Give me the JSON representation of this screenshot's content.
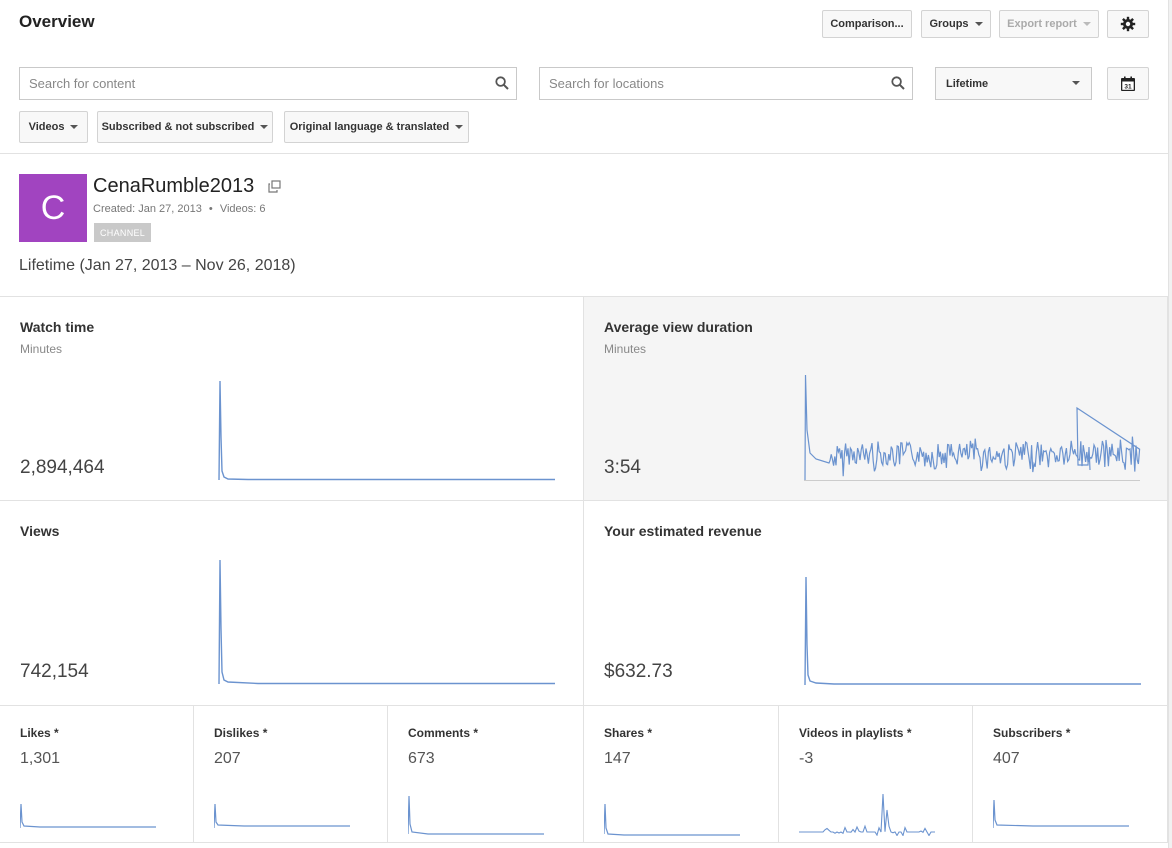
{
  "header": {
    "title": "Overview",
    "comparison_label": "Comparison...",
    "groups_label": "Groups",
    "export_label": "Export report"
  },
  "filters": {
    "content_search_placeholder": "Search for content",
    "location_search_placeholder": "Search for locations",
    "date_range": "Lifetime",
    "calendar_day": "31",
    "content_type": "Videos",
    "subscription": "Subscribed & not subscribed",
    "language": "Original language & translated"
  },
  "channel": {
    "avatar_letter": "C",
    "avatar_color": "#a144c0",
    "name": "CenaRumble2013",
    "created": "Created: Jan 27, 2013",
    "separator": "•",
    "videos": "Videos: 6",
    "badge": "CHANNEL",
    "range": "Lifetime (Jan 27, 2013 – Nov 26, 2018)"
  },
  "metrics": {
    "watch_time": {
      "label": "Watch time",
      "unit": "Minutes",
      "value": "2,894,464"
    },
    "avg_duration": {
      "label": "Average view duration",
      "unit": "Minutes",
      "value": "3:54"
    },
    "views": {
      "label": "Views",
      "value": "742,154"
    },
    "revenue": {
      "label": "Your estimated revenue",
      "value": "$632.73"
    }
  },
  "small_metrics": [
    {
      "label": "Likes *",
      "value": "1,301"
    },
    {
      "label": "Dislikes *",
      "value": "207"
    },
    {
      "label": "Comments *",
      "value": "673"
    },
    {
      "label": "Shares *",
      "value": "147"
    },
    {
      "label": "Videos in playlists *",
      "value": "-3"
    },
    {
      "label": "Subscribers *",
      "value": "407"
    }
  ],
  "colors": {
    "line": "#6b93cf",
    "selected_card": "#f5f5f5",
    "border": "#e2e2e2"
  },
  "icons": {
    "content_search": "search-icon",
    "location_search": "search-icon",
    "settings": "gear-icon",
    "calendar": "calendar-icon",
    "open_channel": "external-link-icon"
  }
}
